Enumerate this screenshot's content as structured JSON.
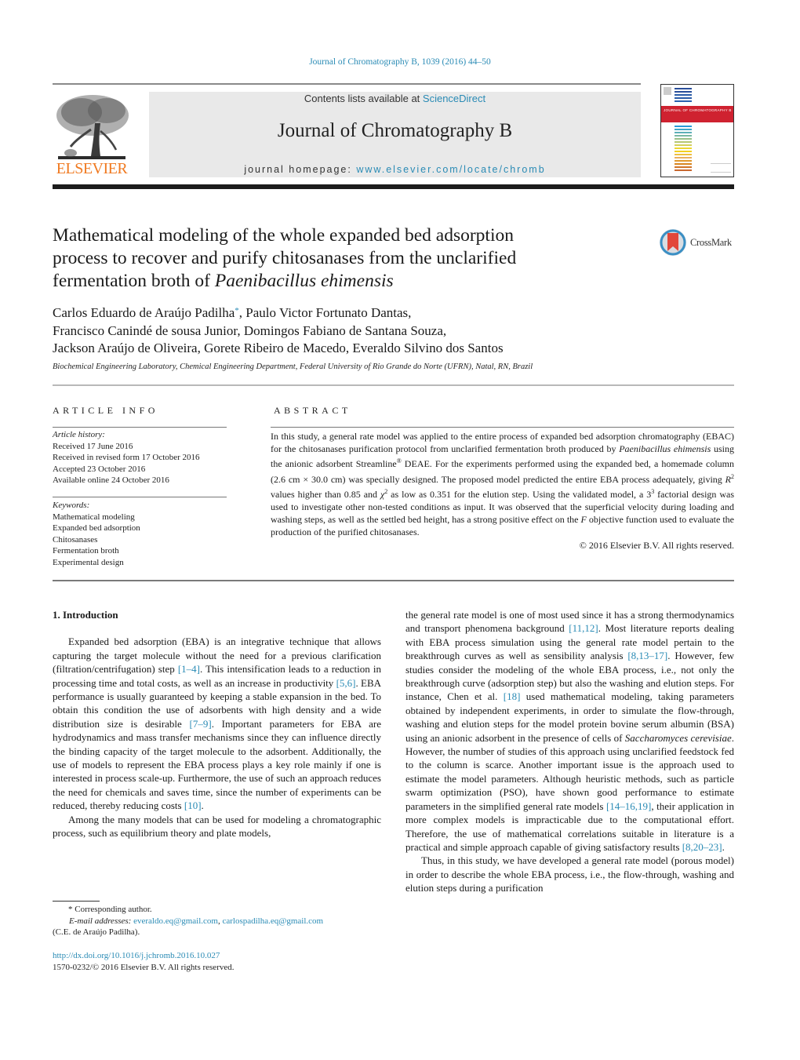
{
  "header": {
    "citation": "Journal of Chromatography B, 1039 (2016) 44–50",
    "publisher_logo_text": "ELSEVIER",
    "contents_prefix": "Contents lists available at ",
    "contents_link": "ScienceDirect",
    "journal_title": "Journal of Chromatography B",
    "homepage_prefix": "journal homepage: ",
    "homepage_link": "www.elsevier.com/locate/chromb",
    "cover_band_text": "JOURNAL OF CHROMATOGRAPHY B",
    "crossmark_label": "CrossMark",
    "colors": {
      "link": "#2a8bb5",
      "elsevier_orange": "#f07a21",
      "cover_red": "#cf2230"
    }
  },
  "article": {
    "title_line1": "Mathematical modeling of the whole expanded bed adsorption",
    "title_line2": "process to recover and purify chitosanases from the unclarified",
    "title_line3_prefix": "fermentation broth of ",
    "title_line3_italic": "Paenibacillus ehimensis",
    "authors_line1_a": "Carlos Eduardo de Araújo Padilha",
    "authors_star": "*",
    "authors_line1_b": ", Paulo Victor Fortunato Dantas,",
    "authors_line2": "Francisco Canindé de sousa Junior, Domingos Fabiano de Santana Souza,",
    "authors_line3": "Jackson Araújo de Oliveira, Gorete Ribeiro de Macedo, Everaldo Silvino dos Santos",
    "affiliation": "Biochemical Engineering Laboratory, Chemical Engineering Department, Federal University of Rio Grande do Norte (UFRN), Natal, RN, Brazil"
  },
  "article_info": {
    "heading": "ARTICLE INFO",
    "history_label": "Article history:",
    "history": [
      "Received 17 June 2016",
      "Received in revised form 17 October 2016",
      "Accepted 23 October 2016",
      "Available online 24 October 2016"
    ],
    "keywords_label": "Keywords:",
    "keywords": [
      "Mathematical modeling",
      "Expanded bed adsorption",
      "Chitosanases",
      "Fermentation broth",
      "Experimental design"
    ]
  },
  "abstract": {
    "heading": "ABSTRACT",
    "p1": "In this study, a general rate model was applied to the entire process of expanded bed adsorption chromatography (EBAC) for the chitosanases purification protocol from unclarified fermentation broth produced by ",
    "p1_italic": "Paenibacillus ehimensis",
    "p2": " using the anionic adsorbent Streamline",
    "p2_reg": "®",
    "p3": " DEAE. For the experiments performed using the expanded bed, a homemade column (2.6 cm × 30.0 cm) was specially designed. The proposed model predicted the entire EBA process adequately, giving ",
    "r_symbol": "R",
    "sup2": "2",
    "p4": " values higher than 0.85 and ",
    "chi_symbol": "χ",
    "p5": " as low as 0.351 for the elution step. Using the validated model, a 3",
    "sup3": "3",
    "p6": " factorial design was used to investigate other non-tested conditions as input. It was observed that the superficial velocity during loading and washing steps, as well as the settled bed height, has a strong positive effect on the ",
    "f_symbol": "F",
    "p7": " objective function used to evaluate the production of the purified chitosanases.",
    "copyright": "© 2016 Elsevier B.V. All rights reserved."
  },
  "body": {
    "section_title": "1.  Introduction",
    "left": {
      "para1_a": "Expanded bed adsorption (EBA) is an integrative technique that allows capturing the target molecule without the need for a previous clarification (filtration/centrifugation) step ",
      "cite1": "[1–4]",
      "para1_b": ". This intensification leads to a reduction in processing time and total costs, as well as an increase in productivity ",
      "cite2": "[5,6]",
      "para1_c": ". EBA performance is usually guaranteed by keeping a stable expansion in the bed. To obtain this condition the use of adsorbents with high density and a wide distribution size is desirable ",
      "cite3": "[7–9]",
      "para1_d": ". Important parameters for EBA are hydrodynamics and mass transfer mechanisms since they can influence directly the binding capacity of the target molecule to the adsorbent. Additionally, the use of models to represent the EBA process plays a key role mainly if one is interested in process scale-up. Furthermore, the use of such an approach reduces the need for chemicals and saves time, since the number of experiments can be reduced, thereby reducing costs ",
      "cite4": "[10]",
      "para1_e": ".",
      "para2": "Among the many models that can be used for modeling a chromatographic process, such as equilibrium theory and plate models,"
    },
    "right": {
      "para1_a": "the general rate model is one of most used since it has a strong thermodynamics and transport phenomena background ",
      "cite1": "[11,12]",
      "para1_b": ". Most literature reports dealing with EBA process simulation using the general rate model pertain to the breakthrough curves as well as sensibility analysis ",
      "cite2": "[8,13–17]",
      "para1_c": ". However, few studies consider the modeling of the whole EBA process, i.e., not only the breakthrough curve (adsorption step) but also the washing and elution steps. For instance, Chen et al. ",
      "cite3": "[18]",
      "para1_d": " used mathematical modeling, taking parameters obtained by independent experiments, in order to simulate the flow-through, washing and elution steps for the model protein bovine serum albumin (BSA) using an anionic adsorbent in the presence of cells of ",
      "italic1": "Saccharomyces cerevisiae",
      "para1_e": ". However, the number of studies of this approach using unclarified feedstock fed to the column is scarce. Another important issue is the approach used to estimate the model parameters. Although heuristic methods, such as particle swarm optimization (PSO), have shown good performance to estimate parameters in the simplified general rate models ",
      "cite4": "[14–16,19]",
      "para1_f": ", their application in more complex models is impracticable due to the computational effort. Therefore, the use of mathematical correlations suitable in literature is a practical and simple approach capable of giving satisfactory results ",
      "cite5": "[8,20–23]",
      "para1_g": ".",
      "para2": "Thus, in this study, we have developed a general rate model (porous model) in order to describe the whole EBA process, i.e., the flow-through, washing and elution steps during a purification"
    }
  },
  "footnotes": {
    "star_line": "*  Corresponding author.",
    "email_label": "E-mail addresses: ",
    "email1": "everaldo.eq@gmail.com",
    "email_sep": ", ",
    "email2": "carlospadilha.eq@gmail.com",
    "email_owner": "(C.E. de Araújo Padilha).",
    "doi": "http://dx.doi.org/10.1016/j.jchromb.2016.10.027",
    "issn_line": "1570-0232/© 2016 Elsevier B.V. All rights reserved."
  }
}
